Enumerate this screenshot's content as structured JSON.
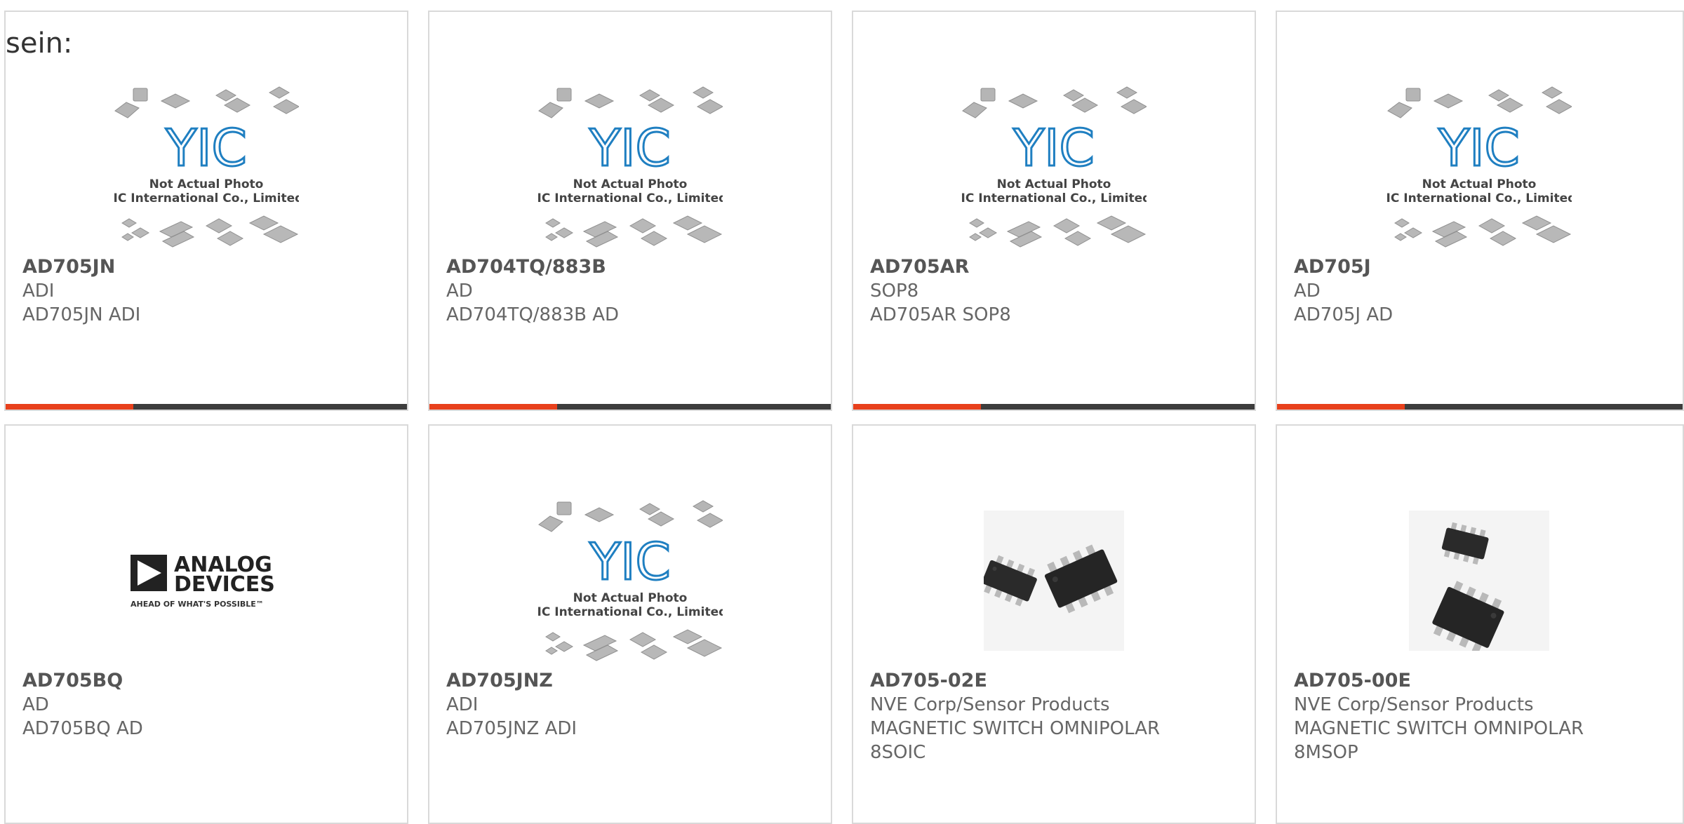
{
  "intro_text": "sein:",
  "placeholder": {
    "logo_text": "YIC",
    "line1": "Not Actual Photo",
    "line2": "YIC International Co., Limited."
  },
  "analog_logo": {
    "line1": "ANALOG",
    "line2": "DEVICES",
    "tagline": "AHEAD OF WHAT'S POSSIBLE™"
  },
  "colors": {
    "accent": "#e8401c",
    "bar": "#3d3d3d",
    "yic_blue": "#1f7fc1"
  },
  "products": [
    {
      "part": "AD705JN",
      "maker": "ADI",
      "desc": "AD705JN ADI",
      "image": "placeholder"
    },
    {
      "part": "AD704TQ/883B",
      "maker": "AD",
      "desc": "AD704TQ/883B AD",
      "image": "placeholder"
    },
    {
      "part": "AD705AR",
      "maker": "SOP8",
      "desc": "AD705AR SOP8",
      "image": "placeholder"
    },
    {
      "part": "AD705J",
      "maker": "AD",
      "desc": "AD705J AD",
      "image": "placeholder"
    },
    {
      "part": "AD705BQ",
      "maker": "AD",
      "desc": "AD705BQ AD",
      "image": "analog-devices-logo"
    },
    {
      "part": "AD705JNZ",
      "maker": "ADI",
      "desc": "AD705JNZ ADI",
      "image": "placeholder"
    },
    {
      "part": "AD705-02E",
      "maker": "NVE Corp/Sensor Products",
      "desc": "MAGNETIC SWITCH OMNIPOLAR 8SOIC",
      "image": "soic-chip-photo"
    },
    {
      "part": "AD705-00E",
      "maker": "NVE Corp/Sensor Products",
      "desc": "MAGNETIC SWITCH OMNIPOLAR 8MSOP",
      "image": "msop-chip-photo"
    }
  ]
}
